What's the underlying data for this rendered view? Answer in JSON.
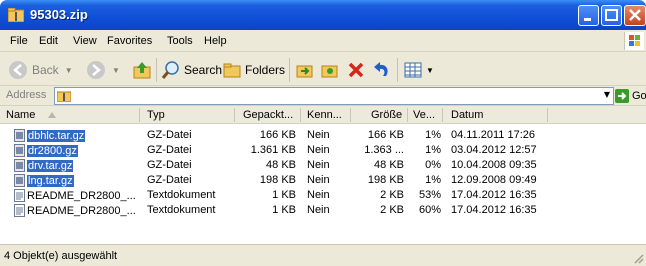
{
  "window": {
    "title": "95303.zip"
  },
  "menu": [
    "File",
    "Edit",
    "View",
    "Favorites",
    "Tools",
    "Help"
  ],
  "toolbar": {
    "back_label": "Back",
    "search_label": "Search",
    "folders_label": "Folders"
  },
  "address": {
    "label": "Address",
    "go_label": "Go"
  },
  "columns": [
    "Name",
    "Typ",
    "Gepackt...",
    "Kenn...",
    "Größe",
    "Ve...",
    "Datum"
  ],
  "files": [
    {
      "name": "dbhlc.tar.gz",
      "type": "GZ-Datei",
      "packed": "166 KB",
      "pw": "Nein",
      "size": "166 KB",
      "ratio": "1%",
      "date": "04.11.2011 17:26",
      "selected": true
    },
    {
      "name": "dr2800.gz",
      "type": "GZ-Datei",
      "packed": "1.361 KB",
      "pw": "Nein",
      "size": "1.363 ...",
      "ratio": "1%",
      "date": "03.04.2012 12:57",
      "selected": true
    },
    {
      "name": "drv.tar.gz",
      "type": "GZ-Datei",
      "packed": "48 KB",
      "pw": "Nein",
      "size": "48 KB",
      "ratio": "0%",
      "date": "10.04.2008 09:35",
      "selected": true
    },
    {
      "name": "lng.tar.gz",
      "type": "GZ-Datei",
      "packed": "198 KB",
      "pw": "Nein",
      "size": "198 KB",
      "ratio": "1%",
      "date": "12.09.2008 09:49",
      "selected": true
    },
    {
      "name": "README_DR2800_...",
      "type": "Textdokument",
      "packed": "1 KB",
      "pw": "Nein",
      "size": "2 KB",
      "ratio": "53%",
      "date": "17.04.2012 16:35",
      "selected": false
    },
    {
      "name": "README_DR2800_...",
      "type": "Textdokument",
      "packed": "1 KB",
      "pw": "Nein",
      "size": "2 KB",
      "ratio": "60%",
      "date": "17.04.2012 16:35",
      "selected": false
    }
  ],
  "status": {
    "text": "4 Objekt(e) ausgewählt"
  },
  "colors": {
    "title_blue": "#0b45c4",
    "selection": "#316ac5",
    "chrome": "#ece9d8"
  }
}
